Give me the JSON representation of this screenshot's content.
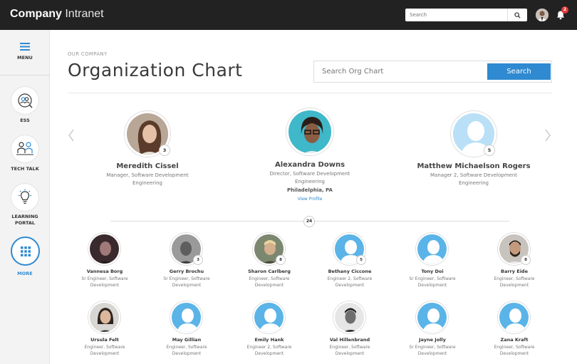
{
  "header": {
    "brand_bold": "Company",
    "brand_rest": "Intranet",
    "search_placeholder": "Search",
    "notification_count": "2"
  },
  "sidebar": {
    "menu_label": "MENU",
    "items": [
      {
        "label": "ESS",
        "icon": "ess-icon"
      },
      {
        "label": "TECH TALK",
        "icon": "tech-talk-icon"
      },
      {
        "label": "LEARNING",
        "label2": "PORTAL",
        "icon": "lightbulb-icon"
      },
      {
        "label": "MORE",
        "icon": "grid-icon"
      }
    ]
  },
  "page": {
    "section": "OUR COMPANY",
    "title": "Organization Chart",
    "search_placeholder": "Search Org Chart",
    "search_button": "Search"
  },
  "managers": [
    {
      "name": "Meredith Cissel",
      "title": "Manager, Software Development",
      "dept": "Engineering",
      "count": "3",
      "photo": "woman-brown"
    },
    {
      "name": "Alexandra Downs",
      "title": "Director, Software Development",
      "dept": "Engineering",
      "location": "Philadelphia, PA",
      "link": "View Profile",
      "photo": "woman-glasses"
    },
    {
      "name": "Matthew Michaelson Rogers",
      "title": "Manager 2, Software Development",
      "dept": "Engineering",
      "count": "5",
      "photo": "silhouette"
    }
  ],
  "report_count": "24",
  "employees_row1": [
    {
      "name": "Vannesa Borg",
      "title": "Sr Engineer, Software",
      "dept": "Development",
      "photo": "dark"
    },
    {
      "name": "Gerry  Brochu",
      "title": "Sr Engineer, Software",
      "dept": "Development",
      "count": "3",
      "photo": "grey-man"
    },
    {
      "name": "Sharon Carlberg",
      "title": "Engineer, Software",
      "dept": "Development",
      "count": "8",
      "photo": "outdoor"
    },
    {
      "name": "Bethany Ciccone",
      "title": "Engineer 2, Software",
      "dept": "Development",
      "count": "5",
      "photo": "silhouette"
    },
    {
      "name": "Tony Doi",
      "title": "Sr Engineer, Software",
      "dept": "Development",
      "photo": "silhouette"
    },
    {
      "name": "Barry Eide",
      "title": "Engineer, Software",
      "dept": "Development",
      "count": "8",
      "photo": "man-beard"
    }
  ],
  "employees_row2": [
    {
      "name": "Ursula Felt",
      "title": "Engineer, Software",
      "dept": "Development",
      "photo": "woman-dark-hair"
    },
    {
      "name": "May Gillian",
      "title": "Engineer, Software",
      "dept": "Development",
      "photo": "silhouette"
    },
    {
      "name": "Emily Hank",
      "title": "Engineer 2, Software",
      "dept": "Development",
      "photo": "silhouette"
    },
    {
      "name": "Val Hillenbrand",
      "title": "Engineer, Software",
      "dept": "Development",
      "photo": "bw-man"
    },
    {
      "name": "Jayne Jolly",
      "title": "Sr Engineer, Software",
      "dept": "Development",
      "photo": "silhouette"
    },
    {
      "name": "Zana Kraft",
      "title": "Engineer, Software",
      "dept": "Development",
      "photo": "silhouette"
    }
  ],
  "colors": {
    "accent": "#2f8ad1",
    "topbar": "#222222",
    "silhouette": "#5ab4e8",
    "badge_red": "#e03a3a"
  }
}
